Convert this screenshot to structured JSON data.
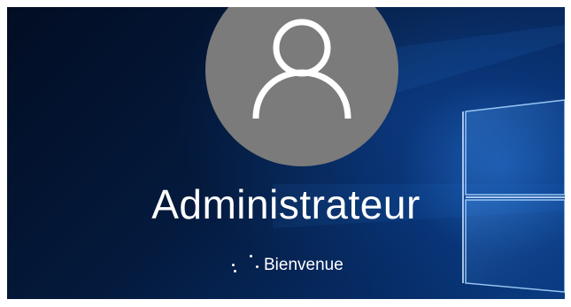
{
  "login": {
    "username": "Administrateur",
    "status_text": "Bienvenue"
  },
  "icons": {
    "avatar": "user-silhouette-icon",
    "spinner": "loading-dots-icon",
    "logo": "windows-logo"
  },
  "colors": {
    "avatar_bg": "#7b7b7b",
    "background_dark": "#020d23",
    "background_light": "#0a3c82",
    "text": "#ffffff"
  }
}
